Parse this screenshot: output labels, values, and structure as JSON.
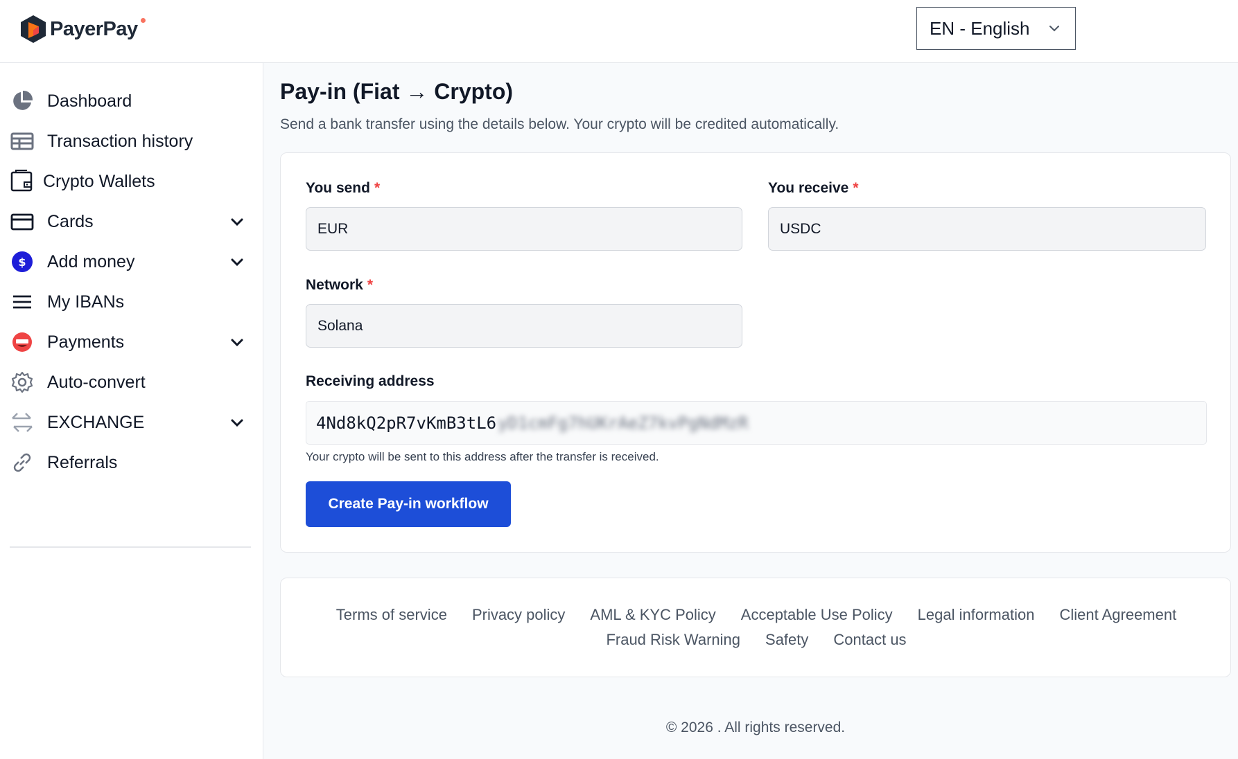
{
  "header": {
    "brand": "PayerPay",
    "language": "EN - English"
  },
  "sidebar": {
    "items": [
      {
        "label": "Dashboard",
        "icon": "pie-chart-icon"
      },
      {
        "label": "Transaction history",
        "icon": "table-icon"
      },
      {
        "label": "Crypto Wallets",
        "icon": "wallet-icon"
      },
      {
        "label": "Cards",
        "icon": "credit-card-icon",
        "expandable": true
      },
      {
        "label": "Add money",
        "icon": "add-money-icon",
        "expandable": true
      },
      {
        "label": "My IBANs",
        "icon": "menu-lines-icon"
      },
      {
        "label": "Payments",
        "icon": "payments-icon",
        "expandable": true
      },
      {
        "label": "Auto-convert",
        "icon": "gear-icon"
      },
      {
        "label": "EXCHANGE",
        "icon": "exchange-arrows-icon",
        "expandable": true
      },
      {
        "label": "Referrals",
        "icon": "link-icon"
      }
    ]
  },
  "main": {
    "title": "Pay-in (Fiat → Crypto)",
    "subtitle": "Send a bank transfer using the details below. Your crypto will be credited automatically.",
    "form": {
      "send_label": "You send",
      "send_value": "EUR",
      "receive_label": "You receive",
      "receive_value": "USDC",
      "network_label": "Network",
      "network_value": "Solana",
      "required_mark": "*",
      "address_label": "Receiving address",
      "address_visible": "4Nd8kQ2pR7vKmB3tL6",
      "address_redacted": "yD1cmFg7hUKrAeZ7kvPgNdMzR",
      "address_hint": "Your crypto will be sent to this address after the transfer is received.",
      "submit_label": "Create Pay-in workflow"
    }
  },
  "footer": {
    "links_row1": [
      "Terms of service",
      "Privacy policy",
      "AML & KYC Policy",
      "Acceptable Use Policy",
      "Legal information",
      "Client Agreement"
    ],
    "links_row2": [
      "Fraud Risk Warning",
      "Safety",
      "Contact us"
    ],
    "copyright": "© 2026 . All rights reserved."
  },
  "colors": {
    "primary": "#1d4ed8",
    "required": "#ef4444",
    "brand_accent": "#f97360"
  }
}
